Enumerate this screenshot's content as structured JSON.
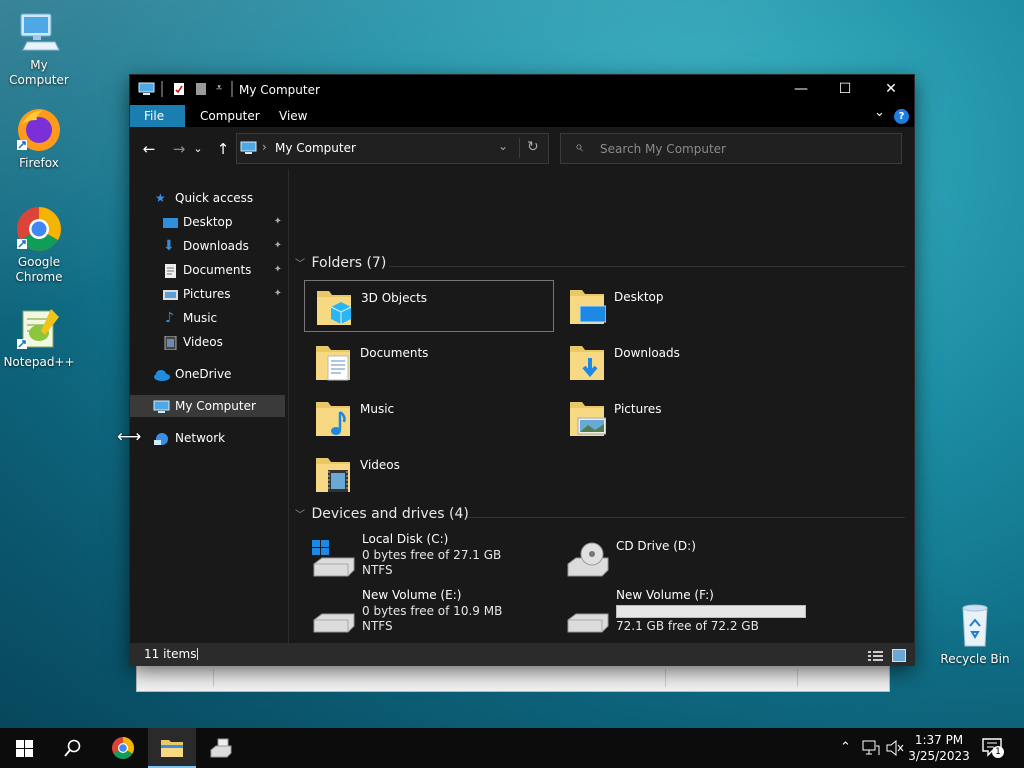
{
  "desktop": {
    "icons": [
      {
        "label": "My Computer"
      },
      {
        "label": "Firefox"
      },
      {
        "label": "Google Chrome"
      },
      {
        "label": "Notepad++"
      },
      {
        "label": "Recycle Bin"
      }
    ]
  },
  "window": {
    "title": "My Computer",
    "minimize_glyph": "—",
    "maximize_glyph": "☐",
    "close_glyph": "✕",
    "tabs": [
      {
        "label": "File"
      },
      {
        "label": "Computer"
      },
      {
        "label": "View"
      }
    ],
    "ribbon_chevron": "⌄",
    "help_glyph": "?",
    "nav": {
      "back": "←",
      "forward": "→",
      "recent": "⌄",
      "up": "↑"
    },
    "address": {
      "separator": "›",
      "location": "My Computer",
      "dropdown": "⌄",
      "refresh": "↻"
    },
    "search": {
      "placeholder": "Search My Computer",
      "icon": "⌕"
    }
  },
  "sidebar": {
    "items": [
      {
        "label": "Quick access",
        "icon": "star-icon"
      },
      {
        "label": "Desktop",
        "icon": "desktop-icon",
        "pinned": true
      },
      {
        "label": "Downloads",
        "icon": "download-icon",
        "pinned": true
      },
      {
        "label": "Documents",
        "icon": "document-icon",
        "pinned": true
      },
      {
        "label": "Pictures",
        "icon": "picture-icon",
        "pinned": true
      },
      {
        "label": "Music",
        "icon": "music-icon"
      },
      {
        "label": "Videos",
        "icon": "video-icon"
      },
      {
        "label": "OneDrive",
        "icon": "cloud-icon"
      },
      {
        "label": "My Computer",
        "icon": "computer-icon",
        "selected": true
      },
      {
        "label": "Network",
        "icon": "network-icon"
      }
    ],
    "pin_glyph": "📌"
  },
  "folders": {
    "heading": "Folders (7)",
    "items": [
      {
        "name": "3D Objects"
      },
      {
        "name": "Desktop"
      },
      {
        "name": "Documents"
      },
      {
        "name": "Downloads"
      },
      {
        "name": "Music"
      },
      {
        "name": "Pictures"
      },
      {
        "name": "Videos"
      }
    ]
  },
  "drives": {
    "heading": "Devices and drives (4)",
    "items": [
      {
        "name": "Local Disk (C:)",
        "free": "0 bytes free of 27.1 GB",
        "fs": "NTFS"
      },
      {
        "name": "CD Drive (D:)"
      },
      {
        "name": "New Volume (E:)",
        "free": "0 bytes free of 10.9 MB",
        "fs": "NTFS"
      },
      {
        "name": "New Volume (F:)",
        "free": "72.1 GB free of 72.2 GB",
        "used_fraction": 0.0
      }
    ]
  },
  "status": {
    "count": "11 items"
  },
  "taskbar": {
    "time": "1:37 PM",
    "date": "3/25/2023",
    "tray_chevron": "⌃",
    "notification_count": "1"
  },
  "colors": {
    "accent": "#1a7fb0",
    "drive_bar": "#26a0da"
  }
}
